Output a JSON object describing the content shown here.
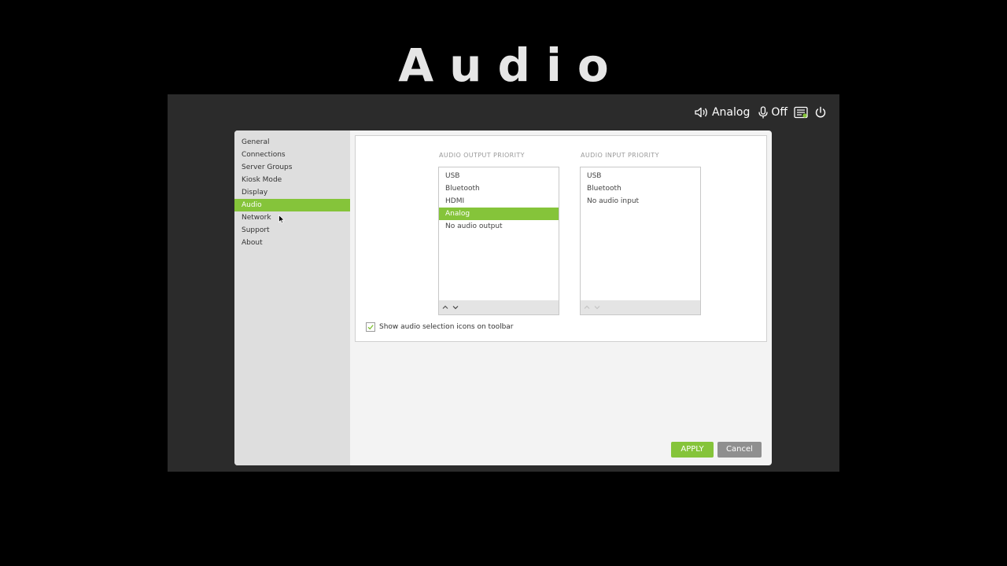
{
  "page": {
    "title": "Audio"
  },
  "toolbar": {
    "output_label": "Analog",
    "mic_label": "Off",
    "icons": [
      "speaker-icon",
      "microphone-icon",
      "display-icon",
      "power-icon"
    ]
  },
  "sidebar": {
    "items": [
      {
        "label": "General"
      },
      {
        "label": "Connections"
      },
      {
        "label": "Server Groups"
      },
      {
        "label": "Kiosk Mode"
      },
      {
        "label": "Display"
      },
      {
        "label": "Audio",
        "active": true
      },
      {
        "label": "Network"
      },
      {
        "label": "Support"
      },
      {
        "label": "About"
      }
    ]
  },
  "audio_output": {
    "title": "AUDIO OUTPUT PRIORITY",
    "items": [
      {
        "label": "USB"
      },
      {
        "label": "Bluetooth"
      },
      {
        "label": "HDMI"
      },
      {
        "label": "Analog",
        "selected": true
      },
      {
        "label": "No audio output"
      }
    ]
  },
  "audio_input": {
    "title": "AUDIO INPUT PRIORITY",
    "items": [
      {
        "label": "USB"
      },
      {
        "label": "Bluetooth"
      },
      {
        "label": "No audio input"
      }
    ]
  },
  "options": {
    "show_icons_label": "Show audio selection icons on toolbar",
    "show_icons_checked": true
  },
  "buttons": {
    "apply": "APPLY",
    "cancel": "Cancel"
  },
  "colors": {
    "accent": "#85c43a",
    "cancel": "#8f8f8f",
    "sidebar": "#dedede"
  }
}
